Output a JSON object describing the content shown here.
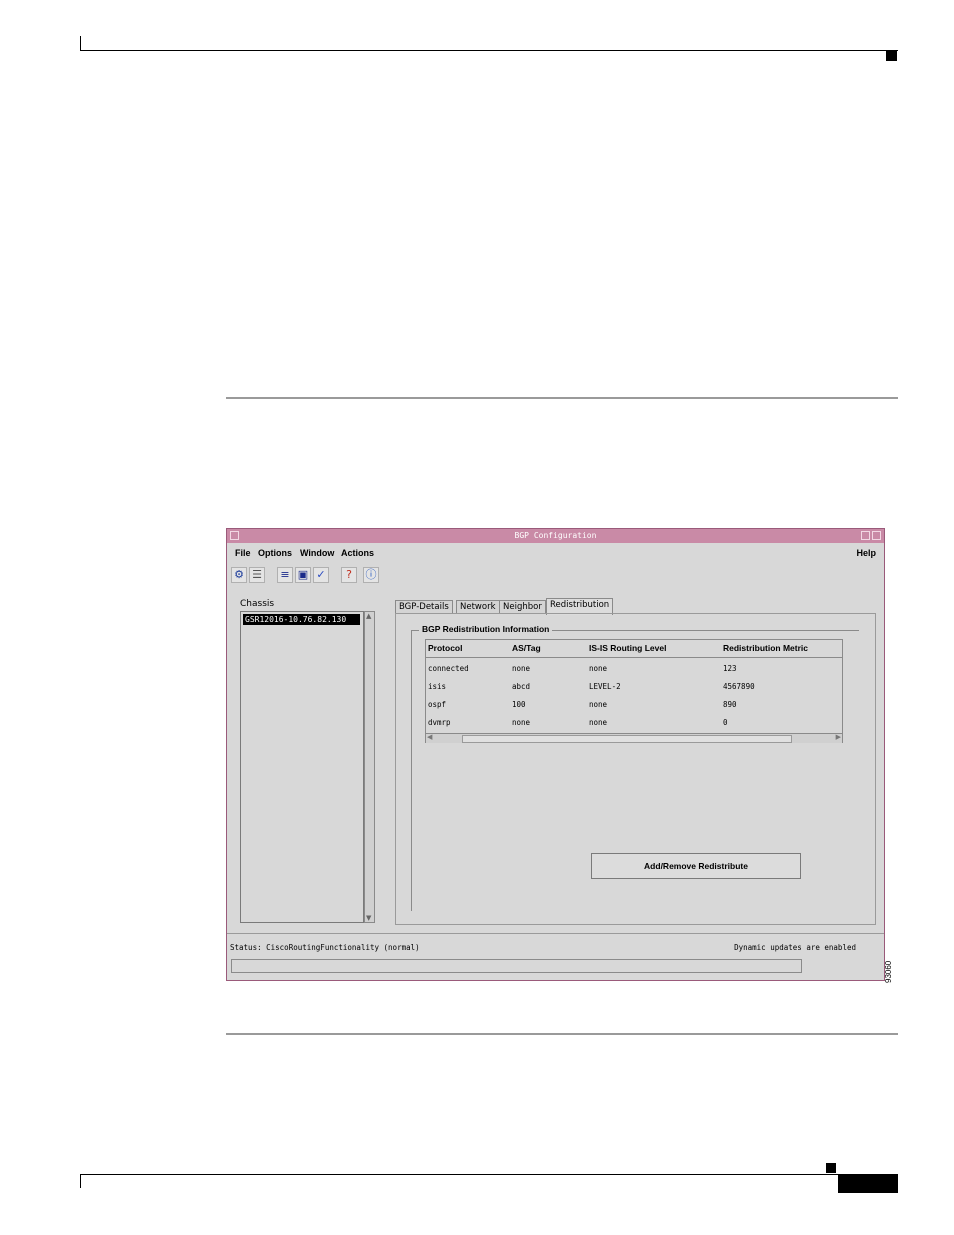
{
  "window": {
    "title": "BGP Configuration",
    "menus": [
      "File",
      "Options",
      "Window",
      "Actions"
    ],
    "help": "Help",
    "toolbar_icons": [
      "run-icon",
      "layers-icon",
      "list-icon",
      "monitor-icon",
      "check-icon",
      "help-icon",
      "info-icon"
    ]
  },
  "chassis": {
    "label": "Chassis",
    "selected": "GSR12016-10.76.82.130"
  },
  "tabs": [
    "BGP-Details",
    "Network",
    "Neighbor",
    "Redistribution"
  ],
  "redistribution": {
    "group_title": "BGP Redistribution Information",
    "columns": [
      "Protocol",
      "AS/Tag",
      "IS-IS Routing Level",
      "Redistribution Metric"
    ],
    "rows": [
      [
        "connected",
        "none",
        "none",
        "123"
      ],
      [
        "isis",
        "abcd",
        "LEVEL-2",
        "4567890"
      ],
      [
        "ospf",
        "100",
        "none",
        "890"
      ],
      [
        "dvmrp",
        "none",
        "none",
        "0"
      ]
    ],
    "add_remove_label": "Add/Remove Redistribute"
  },
  "status": {
    "left": "Status: CiscoRoutingFunctionality (normal)",
    "right": "Dynamic updates are enabled"
  },
  "figure_id": "93060",
  "colors": {
    "titlebar": "#c98aa6",
    "window_bg": "#d8d8d8"
  }
}
